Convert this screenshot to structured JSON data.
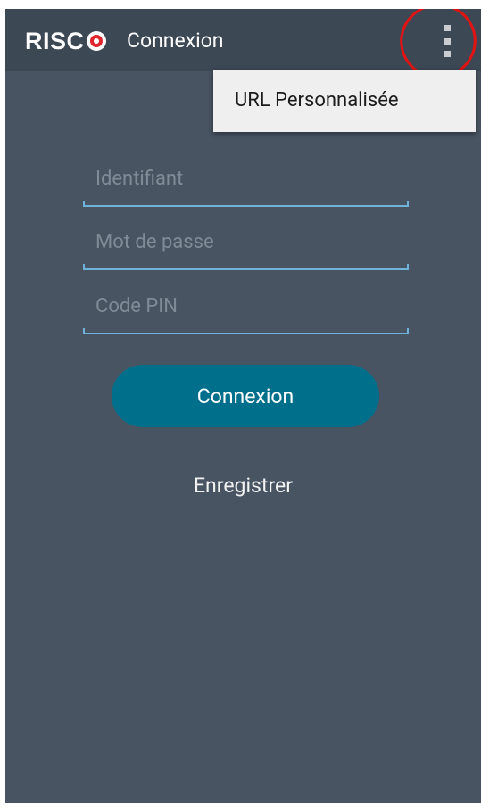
{
  "app": {
    "logo_text": "RISC",
    "title": "Connexion"
  },
  "menu": {
    "items": [
      {
        "label": "URL Personnalisée"
      }
    ]
  },
  "form": {
    "username_placeholder": "Identifiant",
    "password_placeholder": "Mot de passe",
    "pin_placeholder": "Code PIN",
    "login_label": "Connexion",
    "register_label": "Enregistrer"
  },
  "colors": {
    "background": "#485462",
    "appbar": "#3d4855",
    "button": "#006f8c",
    "field_underline": "#6fb3d8",
    "annotation": "#e11414"
  },
  "icons": {
    "overflow": "more-vert-icon",
    "logo": "risco-logo"
  }
}
